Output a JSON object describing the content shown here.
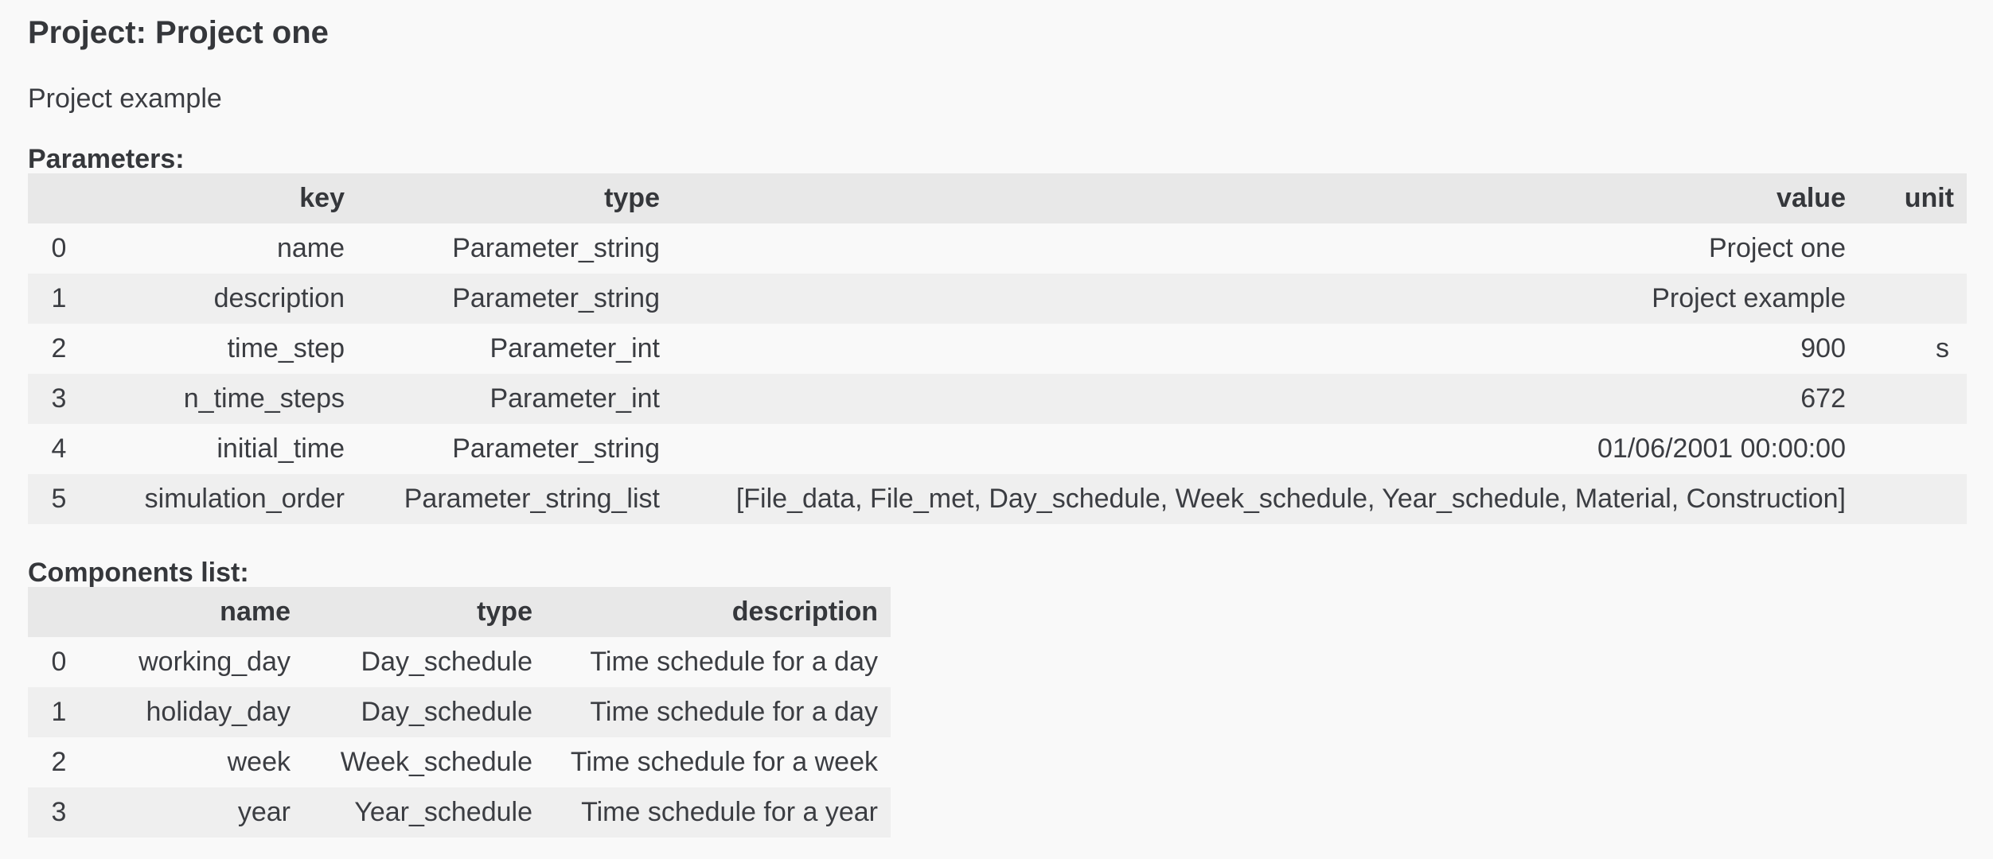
{
  "project": {
    "title": "Project: Project one",
    "description": "Project example"
  },
  "parameters": {
    "label": "Parameters:",
    "headers": {
      "index": "",
      "key": "key",
      "type": "type",
      "value": "value",
      "unit": "unit"
    },
    "rows": [
      {
        "index": "0",
        "key": "name",
        "type": "Parameter_string",
        "value": "Project one",
        "unit": ""
      },
      {
        "index": "1",
        "key": "description",
        "type": "Parameter_string",
        "value": "Project example",
        "unit": ""
      },
      {
        "index": "2",
        "key": "time_step",
        "type": "Parameter_int",
        "value": "900",
        "unit": "s"
      },
      {
        "index": "3",
        "key": "n_time_steps",
        "type": "Parameter_int",
        "value": "672",
        "unit": ""
      },
      {
        "index": "4",
        "key": "initial_time",
        "type": "Parameter_string",
        "value": "01/06/2001 00:00:00",
        "unit": ""
      },
      {
        "index": "5",
        "key": "simulation_order",
        "type": "Parameter_string_list",
        "value": "[File_data, File_met, Day_schedule, Week_schedule, Year_schedule, Material, Construction]",
        "unit": ""
      }
    ]
  },
  "components": {
    "label": "Components list:",
    "headers": {
      "index": "",
      "name": "name",
      "type": "type",
      "description": "description"
    },
    "rows": [
      {
        "index": "0",
        "name": "working_day",
        "type": "Day_schedule",
        "description": "Time schedule for a day"
      },
      {
        "index": "1",
        "name": "holiday_day",
        "type": "Day_schedule",
        "description": "Time schedule for a day"
      },
      {
        "index": "2",
        "name": "week",
        "type": "Week_schedule",
        "description": "Time schedule for a week"
      },
      {
        "index": "3",
        "name": "year",
        "type": "Year_schedule",
        "description": "Time schedule for a year"
      }
    ]
  }
}
